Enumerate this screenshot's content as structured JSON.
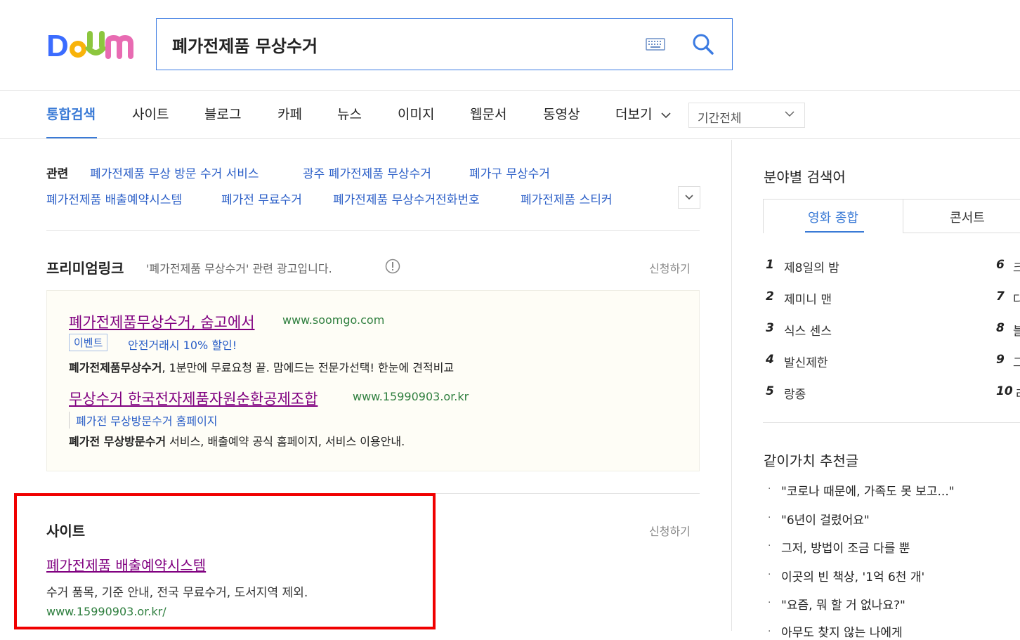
{
  "logo": {
    "text": "Daum",
    "colors": [
      "#3b6cff",
      "#f2494f",
      "#f8b30a",
      "#8cc63e",
      "#e86bb2"
    ]
  },
  "search": {
    "query": "폐가전제품 무상수거"
  },
  "tabs": [
    {
      "label": "통합검색",
      "active": true
    },
    {
      "label": "사이트"
    },
    {
      "label": "블로그"
    },
    {
      "label": "카페"
    },
    {
      "label": "뉴스"
    },
    {
      "label": "이미지"
    },
    {
      "label": "웹문서"
    },
    {
      "label": "동영상"
    },
    {
      "label": "더보기"
    }
  ],
  "period_select": {
    "value": "기간전체"
  },
  "related": {
    "title": "관련",
    "links": [
      "폐가전제품 무상 방문 수거 서비스",
      "광주 폐가전제품 무상수거",
      "폐가구 무상수거",
      "폐가전제품 배출예약시스템",
      "폐가전 무료수거",
      "폐가전제품 무상수거전화번호",
      "폐가전제품 스티커"
    ]
  },
  "premium": {
    "title": "프리미엄링크",
    "desc": "'폐가전제품 무상수거' 관련 광고입니다.",
    "apply": "신청하기",
    "ads": [
      {
        "title": "폐가전제품무상수거, 숨고에서",
        "url": "www.soomgo.com",
        "badge": "이벤트",
        "event": "안전거래시 10% 할인!",
        "desc_bold": "폐가전제품무상수거",
        "desc": ", 1분만에 무료요청 끝. 맘에드는 전문가선택! 한눈에 견적비교"
      },
      {
        "title": "무상수거 한국전자제품자원순환공제조합",
        "url": "www.15990903.or.kr",
        "sublink": "폐가전 무상방문수거 홈페이지",
        "desc_bold": "폐가전 무상방문수거",
        "desc": " 서비스, 배출예약 공식 홈페이지, 서비스 이용안내."
      }
    ]
  },
  "site": {
    "title": "사이트",
    "apply": "신청하기",
    "result": {
      "title": "폐가전제품 배출예약시스템",
      "desc": "수거 품목, 기준 안내, 전국 무료수거, 도서지역 제외.",
      "url": "www.15990903.or.kr/"
    }
  },
  "field": {
    "title": "분야별 검색어",
    "tabs": [
      "영화 종합",
      "콘서트"
    ],
    "ranks": [
      {
        "num": "1",
        "name": "제8일의 밤"
      },
      {
        "num": "2",
        "name": "제미니 맨"
      },
      {
        "num": "3",
        "name": "식스 센스"
      },
      {
        "num": "4",
        "name": "발신제한"
      },
      {
        "num": "5",
        "name": "랑종"
      }
    ],
    "ranks_right": [
      {
        "num": "6",
        "name": "크"
      },
      {
        "num": "7",
        "name": "다"
      },
      {
        "num": "8",
        "name": "블"
      },
      {
        "num": "9",
        "name": "그"
      },
      {
        "num": "10",
        "name": "라"
      }
    ]
  },
  "recommend": {
    "title": "같이가치 추천글",
    "items": [
      "\"코로나 때문에, 가족도 못 보고...\"",
      "\"6년이 걸렸어요\"",
      "그저, 방법이 조금 다를 뿐",
      "이곳의 빈 책상, '1억 6천 개'",
      "\"요즘, 뭐 할 거 없나요?\"",
      "아무도 찾지 않는 나에게"
    ]
  }
}
